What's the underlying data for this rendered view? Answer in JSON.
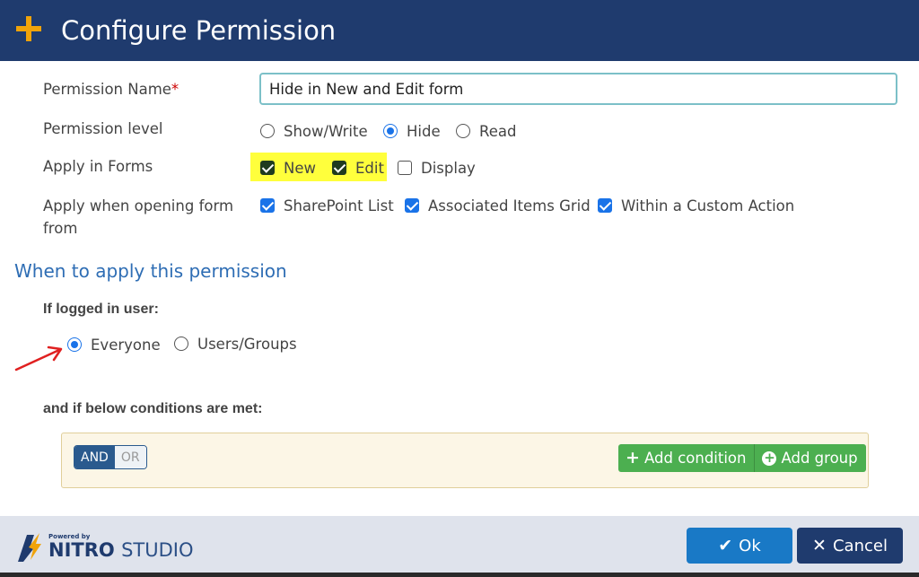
{
  "header": {
    "title": "Configure Permission"
  },
  "form": {
    "permission_name_label": "Permission Name",
    "required_mark": "*",
    "permission_name_value": "Hide in New and Edit form",
    "permission_level_label": "Permission level",
    "permission_levels": [
      "Show/Write",
      "Hide",
      "Read"
    ],
    "selected_level": "Hide",
    "apply_in_forms_label": "Apply in Forms",
    "forms": [
      {
        "label": "New",
        "checked": true
      },
      {
        "label": "Edit",
        "checked": true
      },
      {
        "label": "Display",
        "checked": false
      }
    ],
    "apply_when_label_line1": "Apply when opening form",
    "apply_when_label_line2": "from",
    "sources": [
      {
        "label": "SharePoint List",
        "checked": true
      },
      {
        "label": "Associated Items Grid",
        "checked": true
      },
      {
        "label": "Within a Custom Action",
        "checked": true
      }
    ]
  },
  "when": {
    "section_title": "When to apply this permission",
    "logged_in_label": "If logged in user:",
    "user_options": [
      "Everyone",
      "Users/Groups"
    ],
    "selected_user_option": "Everyone",
    "conditions_label": "and if below conditions are met:",
    "toggle_and": "AND",
    "toggle_or": "OR",
    "add_condition": "Add condition",
    "add_group": "Add group"
  },
  "footer": {
    "logo_powered_by": "Powered by",
    "logo_brand": "NITRO",
    "logo_product": "STUDIO",
    "ok": "Ok",
    "cancel": "Cancel"
  },
  "colors": {
    "header_bg": "#1f3b6e",
    "accent": "#f0a30a",
    "link_blue": "#2e6db4",
    "green": "#4caf50",
    "highlight": "#ffff3c"
  }
}
